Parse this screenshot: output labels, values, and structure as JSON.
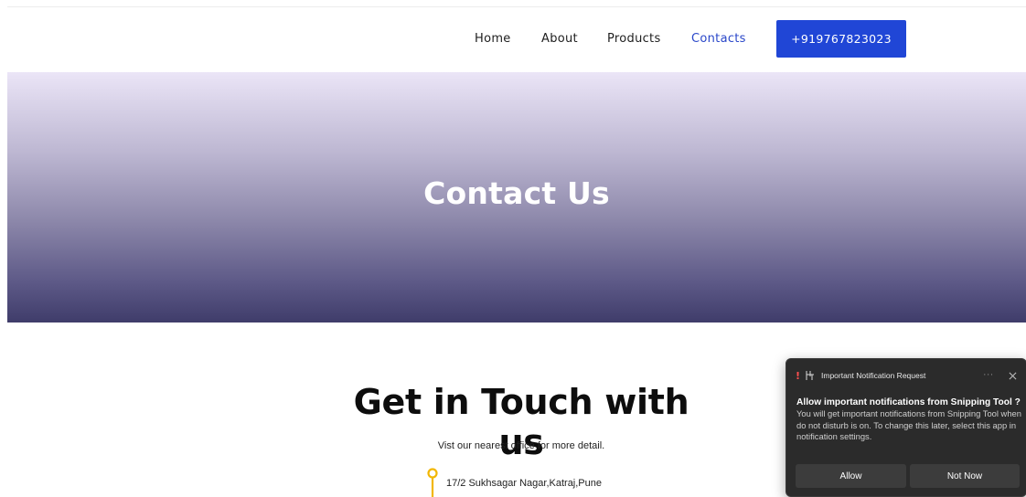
{
  "nav": {
    "items": [
      {
        "label": "Home",
        "active": false
      },
      {
        "label": "About",
        "active": false
      },
      {
        "label": "Products",
        "active": false
      },
      {
        "label": "Contacts",
        "active": true
      }
    ],
    "phone_button": "+919767823023"
  },
  "hero": {
    "title": "Contact Us"
  },
  "contact": {
    "heading": "Get in Touch with us",
    "subtitle": "Vist our nearest office for more detail.",
    "address": "17/2 Sukhsagar Nagar,Katraj,Pune",
    "pin_icon": "map-pin-icon"
  },
  "notification": {
    "app_label": "Important Notification Request",
    "warning_glyph": "!",
    "more_glyph": "···",
    "title": "Allow important notifications from Snipping Tool ?",
    "text": "You will get important notifications from Snipping Tool when do not disturb is on. To change this later, select this app in notification settings.",
    "allow_label": "Allow",
    "deny_label": "Not Now"
  },
  "colors": {
    "accent": "#2046d6",
    "nav_active": "#2a47c9",
    "hero_top": "#ebe5f7",
    "hero_bottom": "#3f3c6a",
    "pin": "#f2b705",
    "toast_bg": "#2b2b2b"
  }
}
